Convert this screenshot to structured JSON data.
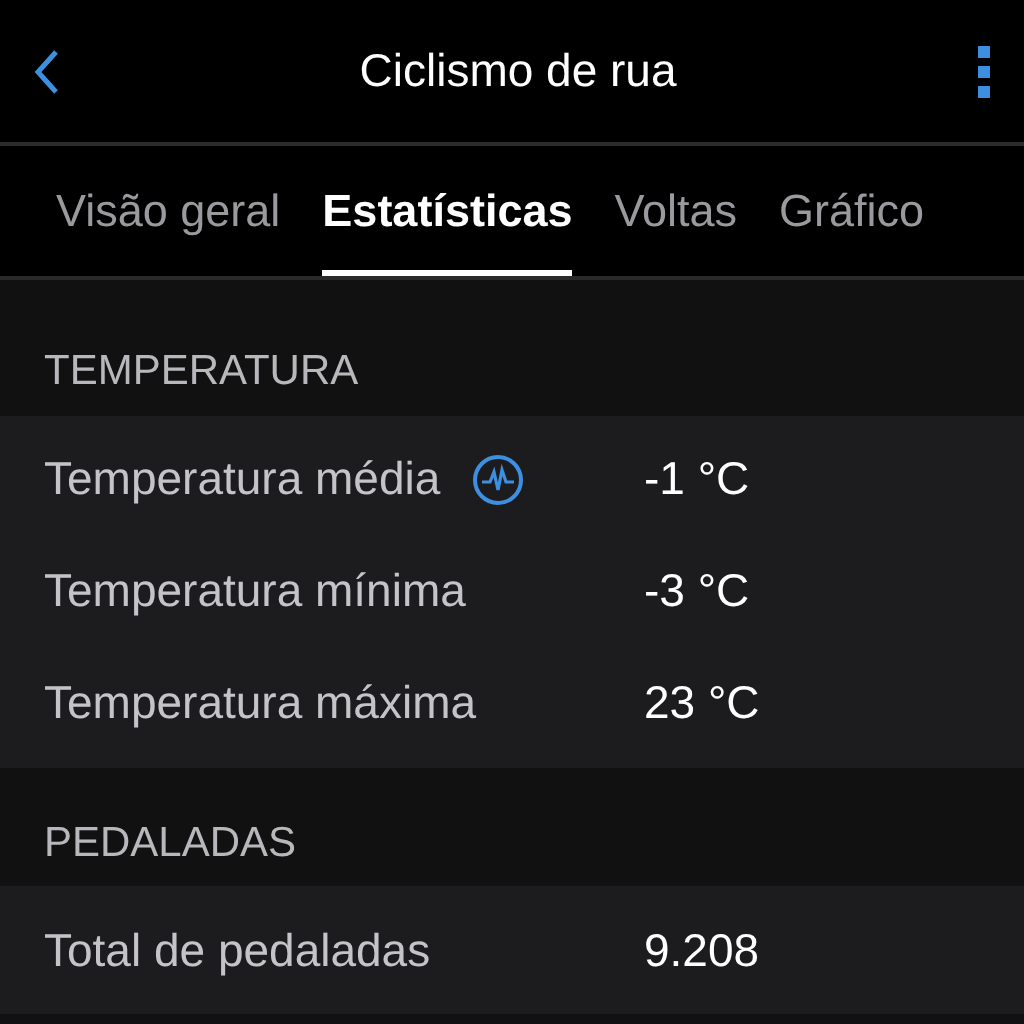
{
  "header": {
    "title": "Ciclismo de rua"
  },
  "tabs": [
    {
      "label": "Visão geral",
      "selected": false
    },
    {
      "label": "Estatísticas",
      "selected": true
    },
    {
      "label": "Voltas",
      "selected": false
    },
    {
      "label": "Gráfico",
      "selected": false
    }
  ],
  "sections": [
    {
      "title": "TEMPERATURA",
      "rows": [
        {
          "label": "Temperatura média",
          "value": "-1 °C",
          "chart_icon": true
        },
        {
          "label": "Temperatura mínima",
          "value": "-3 °C",
          "chart_icon": false
        },
        {
          "label": "Temperatura máxima",
          "value": "23 °C",
          "chart_icon": false
        }
      ]
    },
    {
      "title": "PEDALADAS",
      "rows": [
        {
          "label": "Total de pedaladas",
          "value": "9.208",
          "chart_icon": false
        }
      ]
    }
  ]
}
